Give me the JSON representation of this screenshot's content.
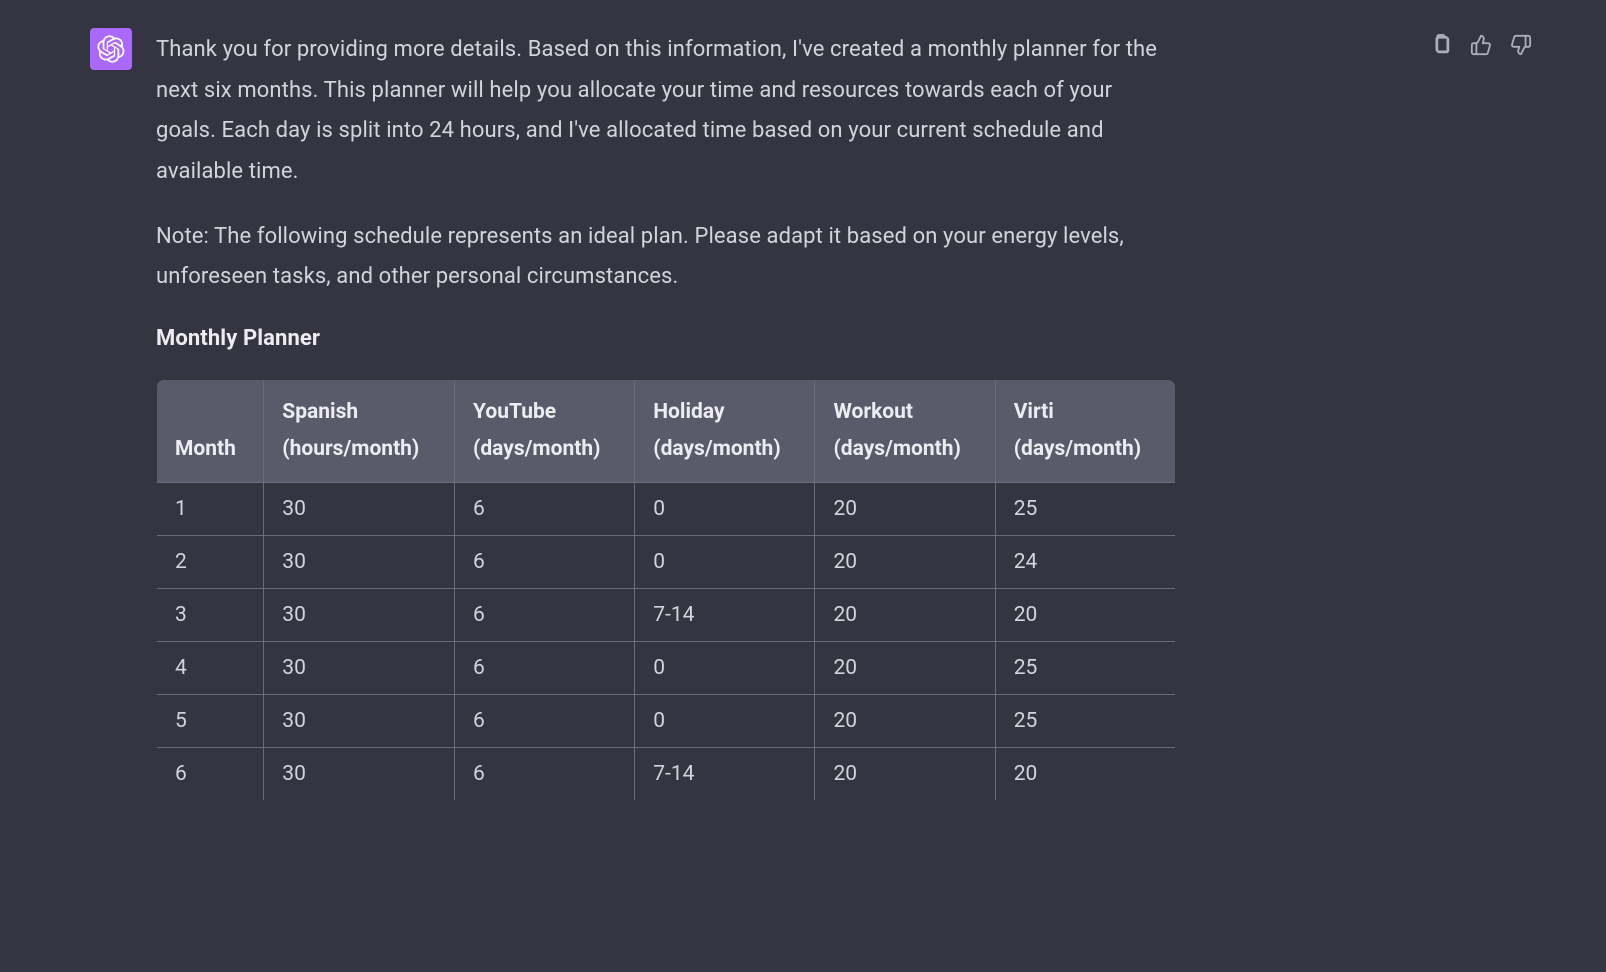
{
  "message": {
    "paragraphs": [
      "Thank you for providing more details. Based on this information, I've created a monthly planner for the next six months. This planner will help you allocate your time and resources towards each of your goals. Each day is split into 24 hours, and I've allocated time based on your current schedule and available time.",
      "Note: The following schedule represents an ideal plan. Please adapt it based on your energy levels, unforeseen tasks, and other personal circumstances."
    ],
    "heading": "Monthly Planner"
  },
  "table": {
    "headers": [
      {
        "line1": "",
        "line2": "Month"
      },
      {
        "line1": "Spanish",
        "line2": "(hours/month)"
      },
      {
        "line1": "YouTube",
        "line2": "(days/month)"
      },
      {
        "line1": "Holiday",
        "line2": "(days/month)"
      },
      {
        "line1": "Workout",
        "line2": "(days/month)"
      },
      {
        "line1": "Virti",
        "line2": "(days/month)"
      }
    ],
    "rows": [
      [
        "1",
        "30",
        "6",
        "0",
        "20",
        "25"
      ],
      [
        "2",
        "30",
        "6",
        "0",
        "20",
        "24"
      ],
      [
        "3",
        "30",
        "6",
        "7-14",
        "20",
        "20"
      ],
      [
        "4",
        "30",
        "6",
        "0",
        "20",
        "25"
      ],
      [
        "5",
        "30",
        "6",
        "0",
        "20",
        "25"
      ],
      [
        "6",
        "30",
        "6",
        "7-14",
        "20",
        "20"
      ]
    ]
  },
  "icons": {
    "copy": "clipboard-icon",
    "thumbsup": "thumbs-up-icon",
    "thumbsdown": "thumbs-down-icon",
    "logo": "openai-icon"
  }
}
